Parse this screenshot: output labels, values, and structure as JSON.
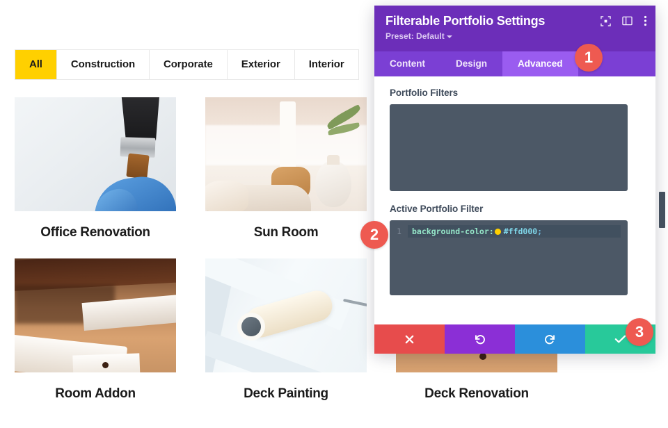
{
  "portfolio": {
    "filters": [
      {
        "label": "All",
        "active": true
      },
      {
        "label": "Construction",
        "active": false
      },
      {
        "label": "Corporate",
        "active": false
      },
      {
        "label": "Exterior",
        "active": false
      },
      {
        "label": "Interior",
        "active": false
      }
    ],
    "items": [
      {
        "title": "Office Renovation",
        "image": "paintbrush-gloved-hand-photo"
      },
      {
        "title": "Sun Room",
        "image": "white-vase-greenery-photo"
      },
      {
        "title": "Room Addon",
        "image": "wood-beam-white-boards-photo"
      },
      {
        "title": "Deck Painting",
        "image": "paint-roller-white-fence-photo"
      },
      {
        "title": "Deck Renovation",
        "image": "deck-wood-boards-photo"
      }
    ]
  },
  "modal": {
    "title": "Filterable Portfolio Settings",
    "preset": "Preset: Default",
    "header_icons": [
      {
        "name": "focus-target-icon"
      },
      {
        "name": "layout-panel-icon"
      },
      {
        "name": "more-vertical-icon"
      }
    ],
    "tabs": [
      {
        "label": "Content",
        "active": false
      },
      {
        "label": "Design",
        "active": false
      },
      {
        "label": "Advanced",
        "active": true
      }
    ],
    "fields": {
      "portfolio_filters": {
        "label": "Portfolio Filters",
        "value": ""
      },
      "active_portfolio_filter": {
        "label": "Active Portfolio Filter",
        "line_number": "1",
        "property": "background-color:",
        "value": "#ffd000",
        "terminator": ";",
        "swatch_color": "#ffd000"
      }
    },
    "actions": [
      {
        "name": "cancel",
        "glyph": "✕",
        "color": "#e74c4c"
      },
      {
        "name": "undo",
        "glyph": "↺",
        "color": "#8b2fd6"
      },
      {
        "name": "redo",
        "glyph": "↻",
        "color": "#2b8fdb"
      },
      {
        "name": "save",
        "glyph": "✓",
        "color": "#28c99a"
      }
    ]
  },
  "callouts": [
    {
      "number": "1"
    },
    {
      "number": "2"
    },
    {
      "number": "3"
    }
  ],
  "colors": {
    "accent_yellow": "#ffd000",
    "header_purple": "#6c2eb9",
    "tabbar_purple": "#7b3fd4",
    "active_tab_purple": "#9a5cf0",
    "badge_red": "#ee5a51",
    "editor_bg": "#4c5866"
  }
}
